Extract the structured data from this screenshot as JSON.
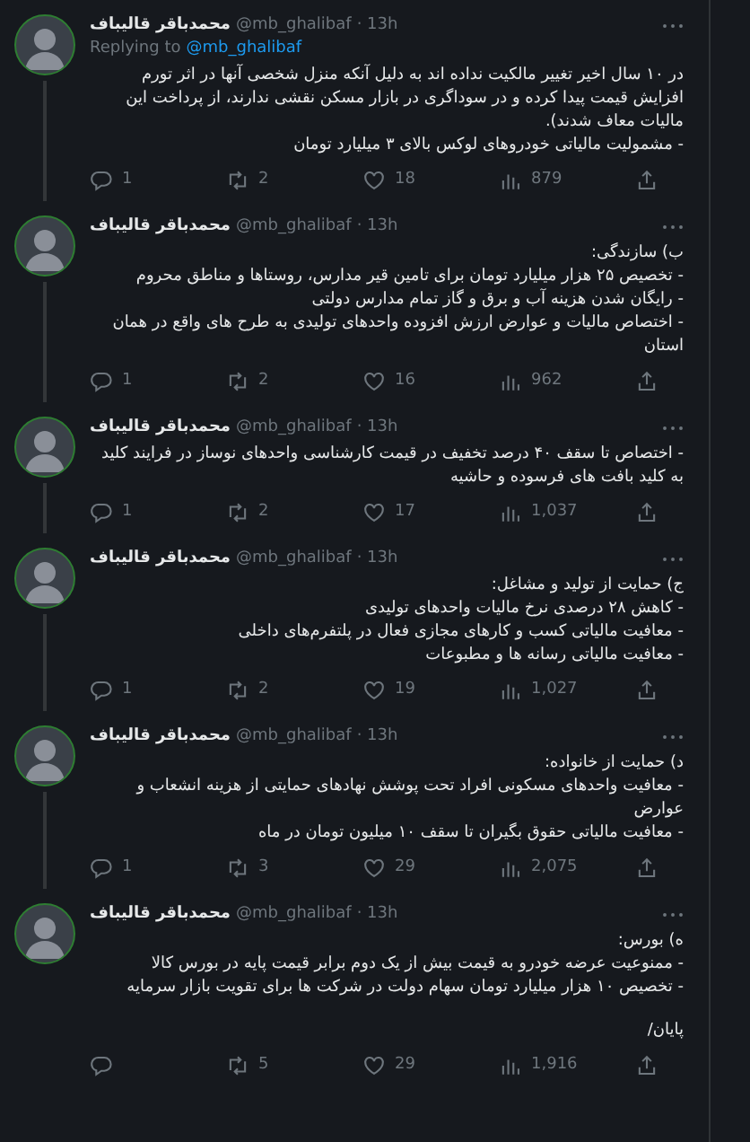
{
  "tweets": [
    {
      "name": "محمدباقر قالیباف",
      "handle": "@mb_ghalibaf",
      "time": "· 13h",
      "replying_to": {
        "label": "Replying to",
        "handle": "@mb_ghalibaf"
      },
      "lines": [
        "در ۱۰ سال اخیر تغییر مالکیت نداده اند به دلیل آنکه منزل شخصی آنها در اثر تورم افزایش قیمت پیدا کرده و در سوداگری در بازار مسکن نقشی ندارند، از پرداخت این مالیات معاف شدند).",
        "- مشمولیت مالیاتی خودروهای لوکس بالای ۳ میلیارد تومان"
      ],
      "replies": "1",
      "retweets": "2",
      "likes": "18",
      "views": "879"
    },
    {
      "name": "محمدباقر قالیباف",
      "handle": "@mb_ghalibaf",
      "time": "· 13h",
      "lines": [
        "ب) سازندگی:",
        "- تخصیص ۲۵ هزار میلیارد تومان برای تامین قیر مدارس، روستاها و مناطق محروم",
        "- رایگان شدن هزینه آب و برق و گاز تمام مدارس دولتی",
        "- اختصاص مالیات و عوارض ارزش افزوده واحدهای تولیدی به طرح های واقع در همان استان"
      ],
      "replies": "1",
      "retweets": "2",
      "likes": "16",
      "views": "962"
    },
    {
      "name": "محمدباقر قالیباف",
      "handle": "@mb_ghalibaf",
      "time": "· 13h",
      "lines": [
        "- اختصاص تا سقف ۴۰ درصد تخفیف در قیمت کارشناسی واحدهای نوساز در فرایند کلید به کلید بافت های فرسوده و حاشیه"
      ],
      "replies": "1",
      "retweets": "2",
      "likes": "17",
      "views": "1,037"
    },
    {
      "name": "محمدباقر قالیباف",
      "handle": "@mb_ghalibaf",
      "time": "· 13h",
      "lines": [
        "ج) حمایت از تولید و مشاغل:",
        "- کاهش ۲۸ درصدی نرخ مالیات واحدهای تولیدی",
        "- معافیت مالیاتی کسب و کارهای مجازی فعال در پلتفرم‌های داخلی",
        "- معافیت مالیاتی رسانه ها و مطبوعات"
      ],
      "replies": "1",
      "retweets": "2",
      "likes": "19",
      "views": "1,027"
    },
    {
      "name": "محمدباقر قالیباف",
      "handle": "@mb_ghalibaf",
      "time": "· 13h",
      "lines": [
        "د) حمایت از خانواده:",
        "- معافیت واحدهای مسکونی افراد تحت پوشش نهادهای حمایتی از هزینه انشعاب و عوارض",
        "- معافیت مالیاتی حقوق بگیران تا سقف ۱۰ میلیون تومان در ماه"
      ],
      "replies": "1",
      "retweets": "3",
      "likes": "29",
      "views": "2,075"
    },
    {
      "name": "محمدباقر قالیباف",
      "handle": "@mb_ghalibaf",
      "time": "· 13h",
      "lines": [
        "ه) بورس:",
        "- ممنوعیت عرضه خودرو به قیمت بیش از یک دوم برابر قیمت پایه در بورس کالا",
        "- تخصیص ۱۰ هزار میلیارد تومان سهام دولت در شرکت ها برای تقویت بازار سرمایه"
      ],
      "closing": "پایان/",
      "retweets": "5",
      "likes": "29",
      "views": "1,916"
    }
  ]
}
